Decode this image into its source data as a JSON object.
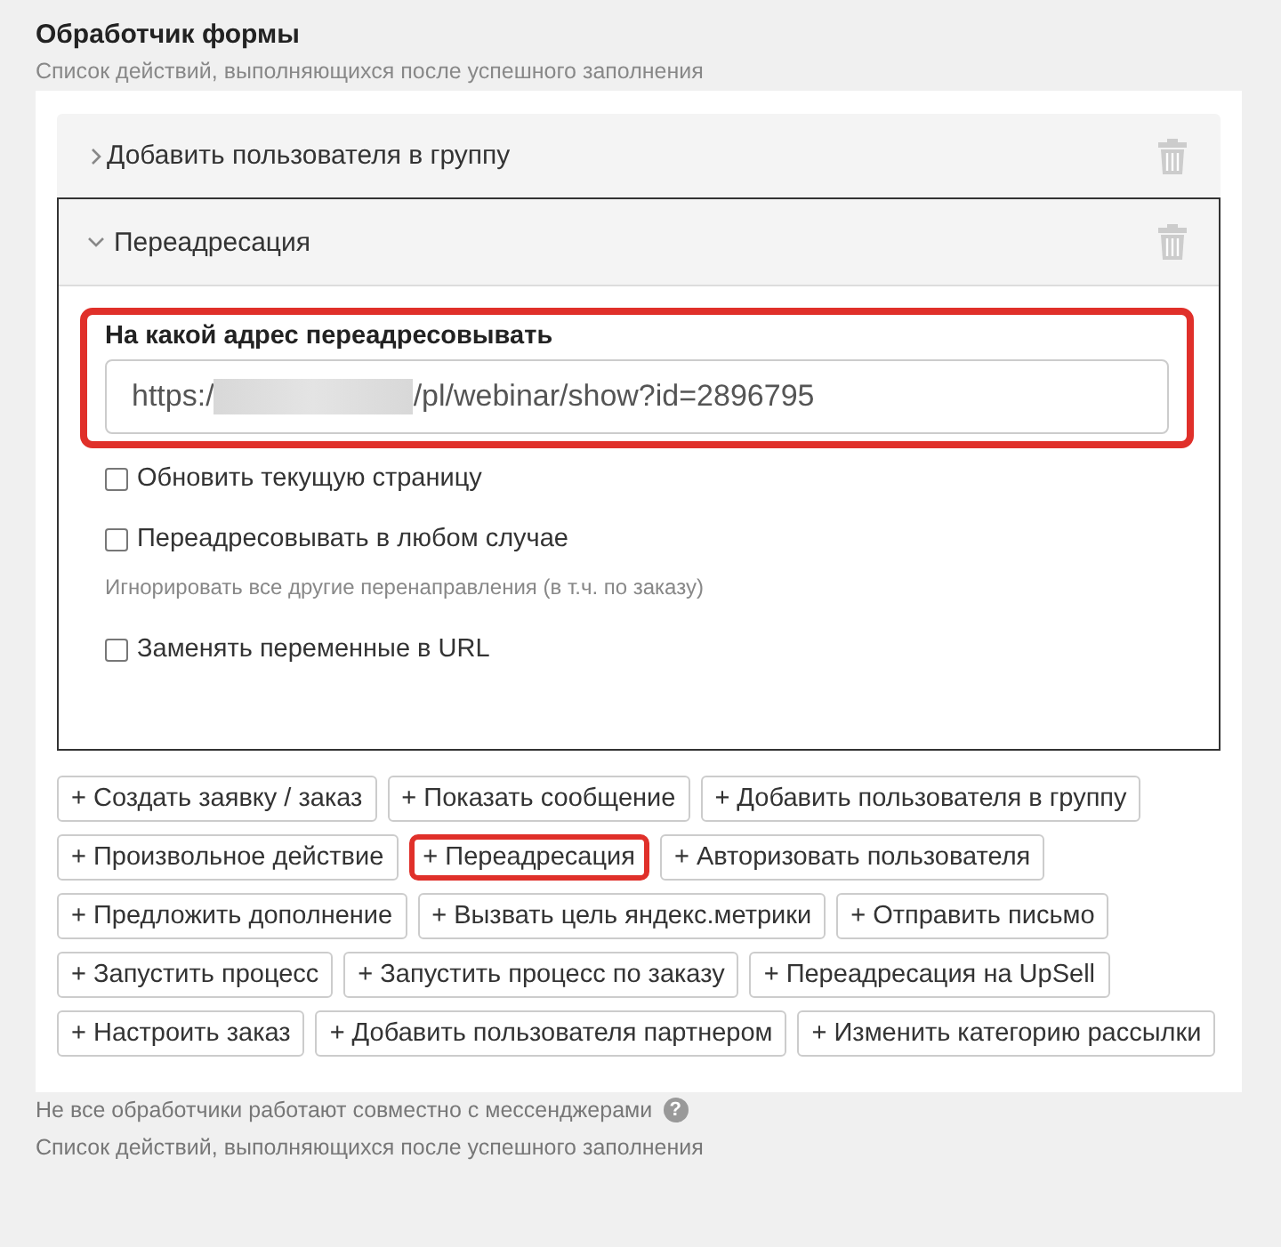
{
  "header": {
    "title": "Обработчик формы",
    "subtitle": "Список действий, выполняющихся после успешного заполнения"
  },
  "actions": [
    {
      "title": "Добавить пользователя в группу",
      "expanded": false
    },
    {
      "title": "Переадресация",
      "expanded": true,
      "field": {
        "label": "На какой адрес переадресовывать",
        "value_start": "https:/",
        "value_end": "/pl/webinar/show?id=2896795",
        "redacted": true,
        "highlighted": true
      },
      "options": [
        {
          "label": "Обновить текущую страницу",
          "checked": false
        },
        {
          "label": "Переадресовывать в любом случае",
          "checked": false,
          "hint": "Игнорировать все другие перенаправления (в т.ч. по заказу)"
        },
        {
          "label": "Заменять переменные в URL",
          "checked": false
        }
      ]
    }
  ],
  "add_buttons": [
    {
      "label": "+ Создать заявку / заказ",
      "highlighted": false
    },
    {
      "label": "+ Показать сообщение",
      "highlighted": false
    },
    {
      "label": "+ Добавить пользователя в группу",
      "highlighted": false
    },
    {
      "label": "+ Произвольное действие",
      "highlighted": false
    },
    {
      "label": "+ Переадресация",
      "highlighted": true
    },
    {
      "label": "+ Авторизовать пользователя",
      "highlighted": false
    },
    {
      "label": "+ Предложить дополнение",
      "highlighted": false
    },
    {
      "label": "+ Вызвать цель яндекс.метрики",
      "highlighted": false
    },
    {
      "label": "+ Отправить письмо",
      "highlighted": false
    },
    {
      "label": "+ Запустить процесс",
      "highlighted": false
    },
    {
      "label": "+ Запустить процесс по заказу",
      "highlighted": false
    },
    {
      "label": "+ Переадресация на UpSell",
      "highlighted": false
    },
    {
      "label": "+ Настроить заказ",
      "highlighted": false
    },
    {
      "label": "+ Добавить пользователя партнером",
      "highlighted": false
    },
    {
      "label": "+ Изменить категорию рассылки",
      "highlighted": false
    }
  ],
  "footer": {
    "note": "Не все обработчики работают совместно с мессенджерами",
    "help_icon": "?",
    "subtitle": "Список действий, выполняющихся после успешного заполнения"
  }
}
